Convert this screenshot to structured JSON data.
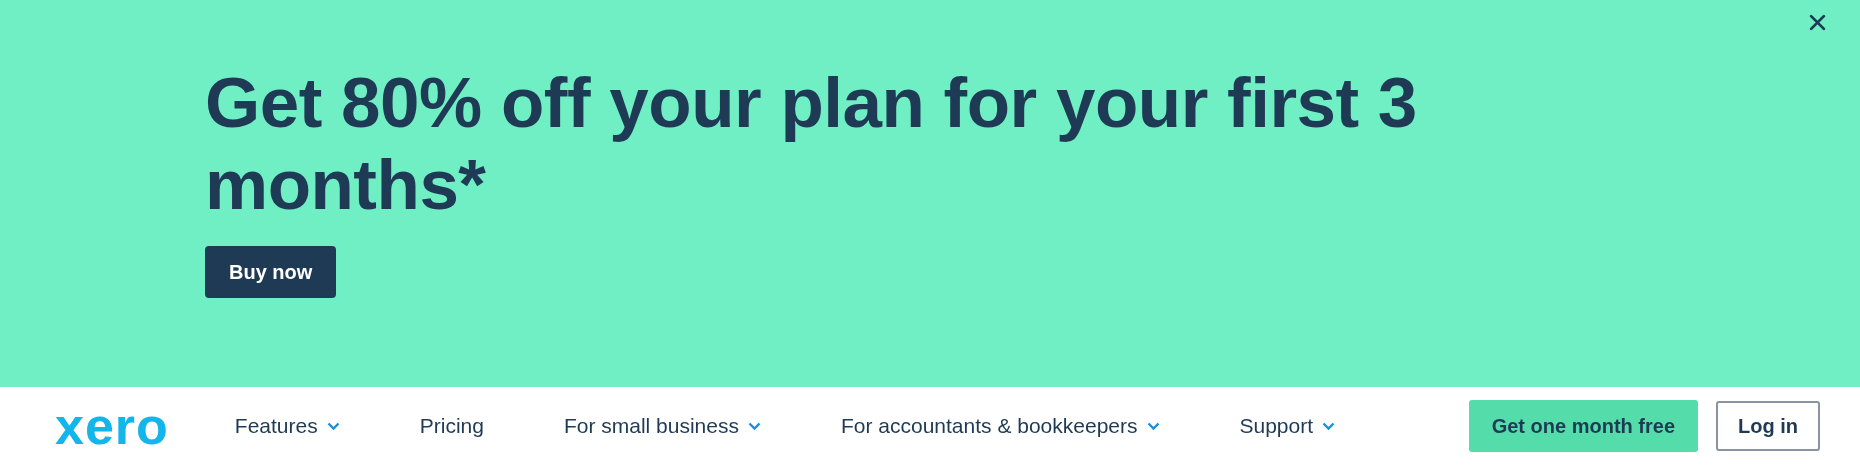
{
  "banner": {
    "heading": "Get 80% off your plan for your first 3 months*",
    "button": "Buy now"
  },
  "nav": {
    "logo": "xero",
    "items": [
      {
        "label": "Features",
        "dropdown": true
      },
      {
        "label": "Pricing",
        "dropdown": false
      },
      {
        "label": "For small business",
        "dropdown": true
      },
      {
        "label": "For accountants & bookkeepers",
        "dropdown": true
      },
      {
        "label": "Support",
        "dropdown": true
      }
    ],
    "cta": "Get one month free",
    "login": "Log in"
  }
}
